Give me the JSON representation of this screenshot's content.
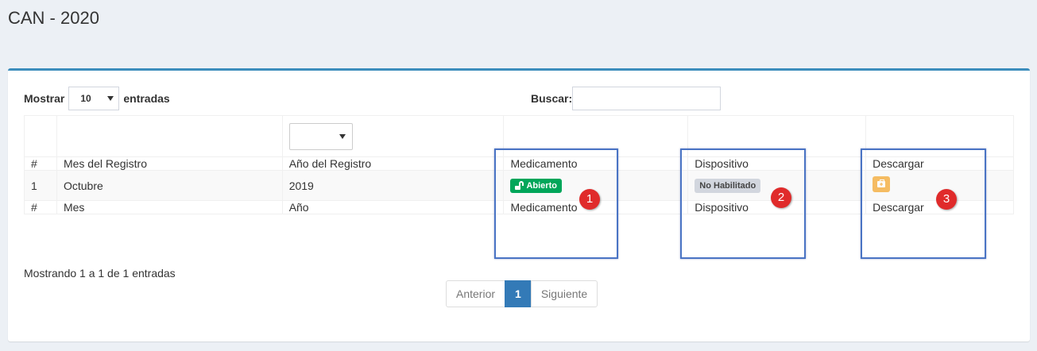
{
  "page": {
    "title": "CAN - 2020"
  },
  "controls": {
    "show_label": "Mostrar",
    "page_size": "10",
    "entries_label": "entradas",
    "search_label": "Buscar:",
    "search_value": ""
  },
  "table": {
    "header": [
      "#",
      "Mes del Registro",
      "Año del Registro",
      "Medicamento",
      "Dispositivo",
      "Descargar"
    ],
    "footer": [
      "#",
      "Mes",
      "Año",
      "Medicamento",
      "Dispositivo",
      "Descargar"
    ],
    "rows": [
      {
        "num": "1",
        "month": "Octubre",
        "year": "2019",
        "medicamento_status": "Abierto",
        "dispositivo_status": "No Habilitado"
      }
    ]
  },
  "info_text": "Mostrando 1 a 1 de 1 entradas",
  "pagination": {
    "previous": "Anterior",
    "current": "1",
    "next": "Siguiente"
  },
  "annotations": [
    "1",
    "2",
    "3"
  ],
  "colors": {
    "accent": "#3c8dbc",
    "open_badge": "#00a65a",
    "download_button": "#f39c12",
    "annotation": "#e02b2b",
    "highlight_box": "#4a74c4"
  }
}
